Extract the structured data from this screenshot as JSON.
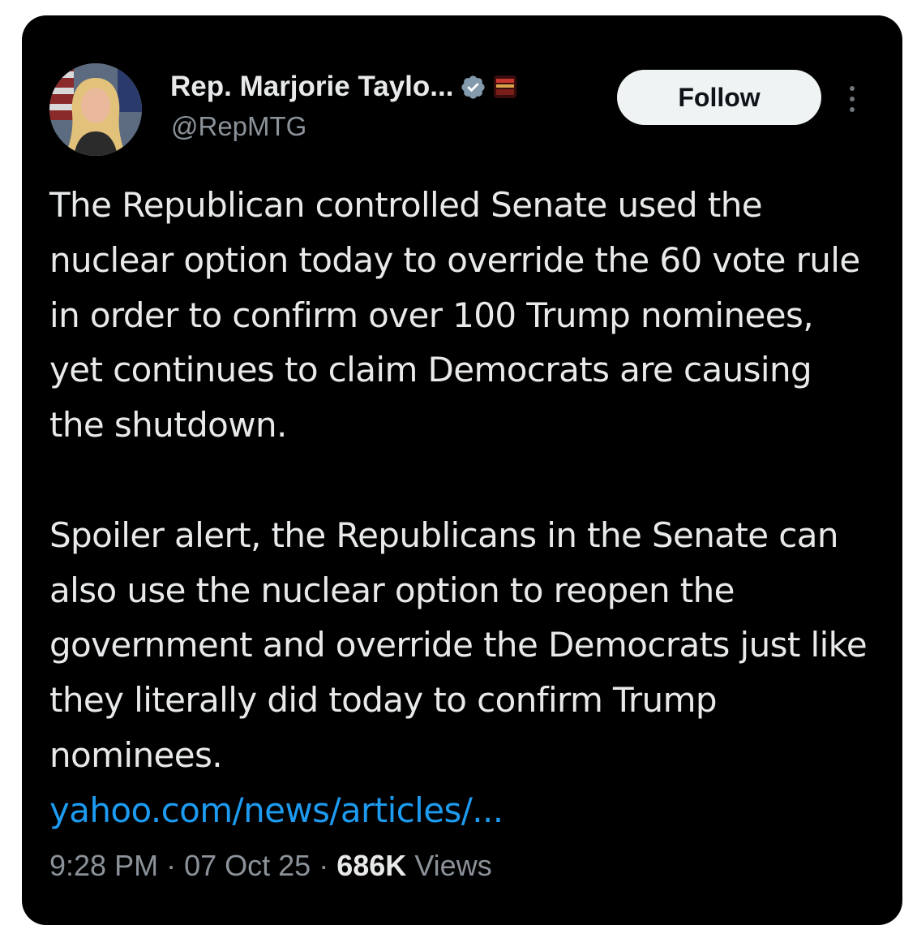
{
  "author": {
    "display_name": "Rep. Marjorie Taylo...",
    "handle": "@RepMTG",
    "verified_icon": "verified-badge-icon",
    "affiliate_icon": "affiliate-badge-icon"
  },
  "actions": {
    "follow_label": "Follow",
    "more_icon": "more-options-icon"
  },
  "tweet": {
    "paragraph_1": "The Republican controlled Senate used the nuclear option today to override the 60 vote rule in order to confirm over 100 Trump nominees, yet continues to claim Democrats are causing the shutdown.",
    "paragraph_2": "Spoiler alert, the Republicans in the Senate can also use the nuclear option to reopen the government and override the Democrats just like they literally did today to confirm Trump nominees.",
    "link_text": "yahoo.com/news/articles/..."
  },
  "meta": {
    "time": "9:28 PM",
    "date": "07 Oct 25",
    "separator": "·",
    "views_count": "686K",
    "views_label": "Views"
  },
  "colors": {
    "background": "#000000",
    "text_primary": "#e7e9ea",
    "text_secondary": "#8b9299",
    "link": "#1d9bf0",
    "verified": "#829aab",
    "follow_bg": "#eff3f4"
  }
}
